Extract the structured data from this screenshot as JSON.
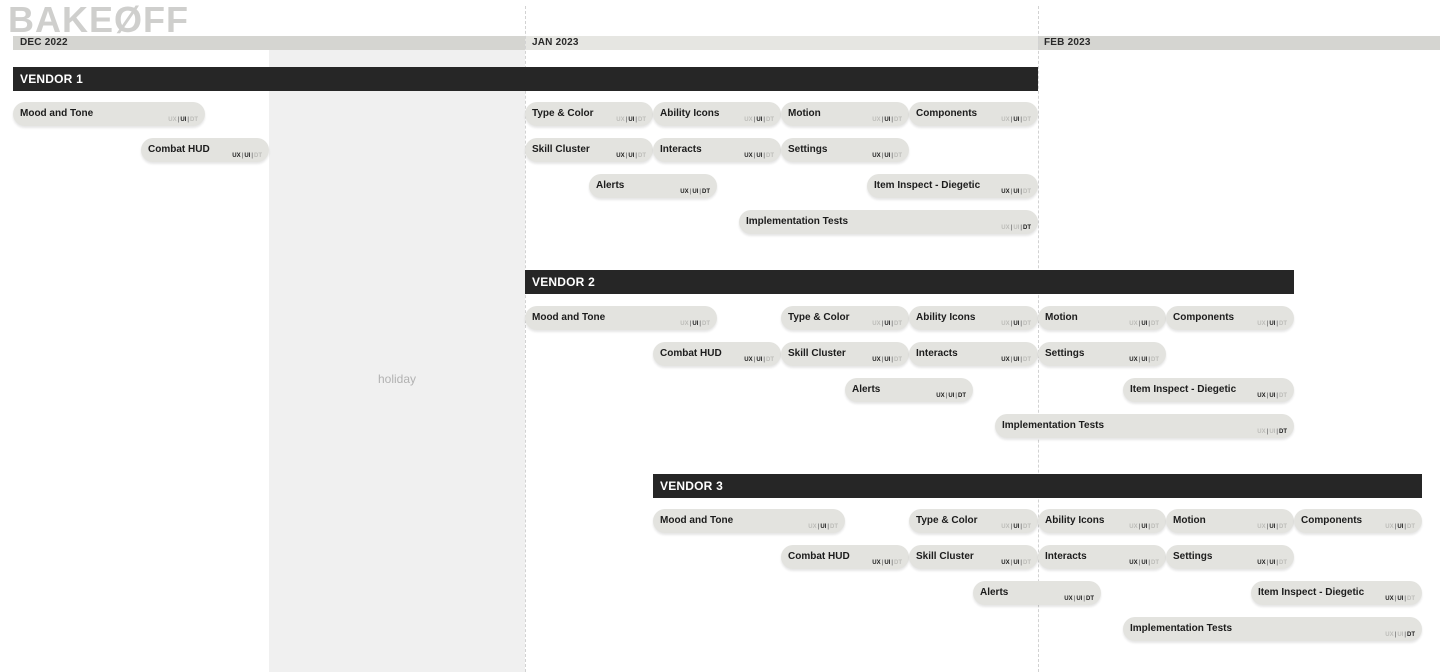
{
  "logo": "BAKEØFF",
  "holiday_label": "holiday",
  "months": [
    "DEC 2022",
    "JAN 2023",
    "FEB 2023"
  ],
  "tags": [
    "UX",
    "UI",
    "DT"
  ],
  "vendors": [
    {
      "name": "VENDOR 1",
      "tasks": [
        {
          "label": "Mood and Tone",
          "active": [
            false,
            true,
            false
          ]
        },
        {
          "label": "Combat HUD",
          "active": [
            true,
            true,
            false
          ]
        },
        {
          "label": "Type & Color",
          "active": [
            false,
            true,
            false
          ]
        },
        {
          "label": "Ability Icons",
          "active": [
            false,
            true,
            false
          ]
        },
        {
          "label": "Motion",
          "active": [
            false,
            true,
            false
          ]
        },
        {
          "label": "Components",
          "active": [
            false,
            true,
            false
          ]
        },
        {
          "label": "Skill Cluster",
          "active": [
            true,
            true,
            false
          ]
        },
        {
          "label": "Interacts",
          "active": [
            true,
            true,
            false
          ]
        },
        {
          "label": "Settings",
          "active": [
            true,
            true,
            false
          ]
        },
        {
          "label": "Alerts",
          "active": [
            true,
            true,
            true
          ]
        },
        {
          "label": "Item Inspect - Diegetic",
          "active": [
            true,
            true,
            false
          ]
        },
        {
          "label": "Implementation Tests",
          "active": [
            false,
            false,
            true
          ]
        }
      ]
    },
    {
      "name": "VENDOR 2",
      "tasks": [
        {
          "label": "Mood and Tone",
          "active": [
            false,
            true,
            false
          ]
        },
        {
          "label": "Type & Color",
          "active": [
            false,
            true,
            false
          ]
        },
        {
          "label": "Ability Icons",
          "active": [
            false,
            true,
            false
          ]
        },
        {
          "label": "Motion",
          "active": [
            false,
            true,
            false
          ]
        },
        {
          "label": "Components",
          "active": [
            false,
            true,
            false
          ]
        },
        {
          "label": "Combat HUD",
          "active": [
            true,
            true,
            false
          ]
        },
        {
          "label": "Skill Cluster",
          "active": [
            true,
            true,
            false
          ]
        },
        {
          "label": "Interacts",
          "active": [
            true,
            true,
            false
          ]
        },
        {
          "label": "Settings",
          "active": [
            true,
            true,
            false
          ]
        },
        {
          "label": "Alerts",
          "active": [
            true,
            true,
            true
          ]
        },
        {
          "label": "Item Inspect - Diegetic",
          "active": [
            true,
            true,
            false
          ]
        },
        {
          "label": "Implementation Tests",
          "active": [
            false,
            false,
            true
          ]
        }
      ]
    },
    {
      "name": "VENDOR 3",
      "tasks": [
        {
          "label": "Mood and Tone",
          "active": [
            false,
            true,
            false
          ]
        },
        {
          "label": "Type & Color",
          "active": [
            false,
            true,
            false
          ]
        },
        {
          "label": "Ability Icons",
          "active": [
            false,
            true,
            false
          ]
        },
        {
          "label": "Motion",
          "active": [
            false,
            true,
            false
          ]
        },
        {
          "label": "Components",
          "active": [
            false,
            true,
            false
          ]
        },
        {
          "label": "Combat HUD",
          "active": [
            true,
            true,
            false
          ]
        },
        {
          "label": "Skill Cluster",
          "active": [
            true,
            true,
            false
          ]
        },
        {
          "label": "Interacts",
          "active": [
            true,
            true,
            false
          ]
        },
        {
          "label": "Settings",
          "active": [
            true,
            true,
            false
          ]
        },
        {
          "label": "Alerts",
          "active": [
            true,
            true,
            true
          ]
        },
        {
          "label": "Item Inspect - Diegetic",
          "active": [
            true,
            true,
            false
          ]
        },
        {
          "label": "Implementation Tests",
          "active": [
            false,
            false,
            true
          ]
        }
      ]
    }
  ]
}
